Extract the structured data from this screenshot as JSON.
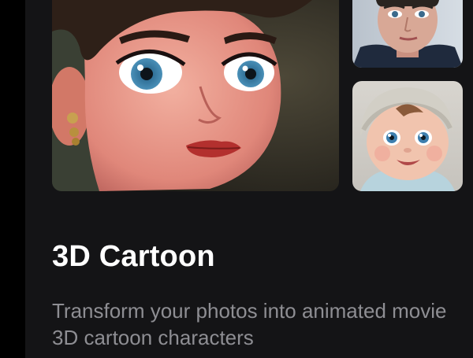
{
  "feature": {
    "title": "3D Cartoon",
    "description": "Transform your photos into animated movie 3D cartoon characters"
  },
  "colors": {
    "background": "#141416",
    "title": "#ffffff",
    "description": "#8e8e93"
  }
}
